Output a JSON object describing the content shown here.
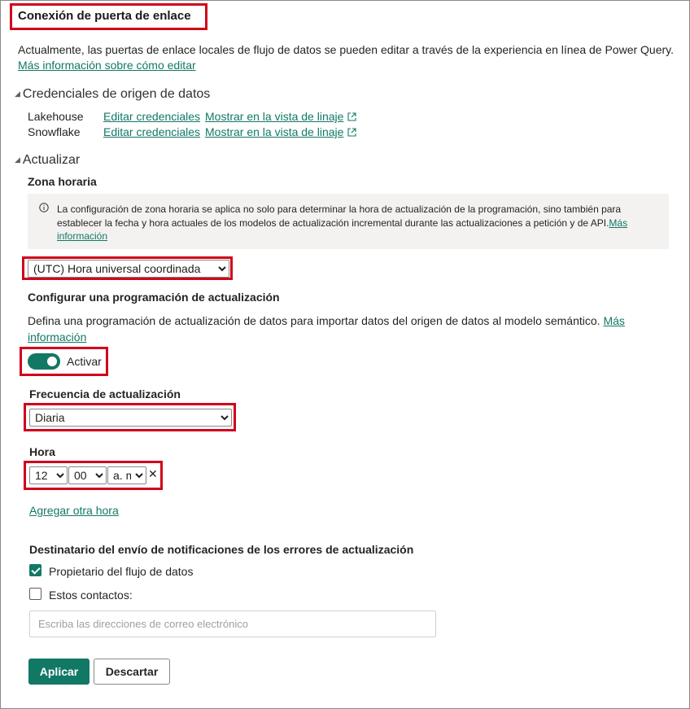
{
  "header": {
    "title": "Conexión de puerta de enlace"
  },
  "intro": {
    "text": "Actualmente, las puertas de enlace locales de flujo de datos se pueden editar a través de la experiencia en línea de Power Query.",
    "link": "Más información sobre cómo editar"
  },
  "credentials": {
    "heading": "Credenciales de origen de datos",
    "rows": [
      {
        "source": "Lakehouse",
        "edit": "Editar credenciales",
        "lineage": "Mostrar en la vista de linaje"
      },
      {
        "source": "Snowflake",
        "edit": "Editar credenciales",
        "lineage": "Mostrar en la vista de linaje"
      }
    ]
  },
  "refresh": {
    "heading": "Actualizar",
    "timezone_label": "Zona horaria",
    "info_text_1": "La configuración de zona horaria se aplica no solo para determinar la hora de actualización de la programación, sino también para",
    "info_text_2": "establecer la fecha y hora actuales de los modelos de actualización incremental durante las actualizaciones a petición y de API.",
    "info_link_1": "Más",
    "info_link_2": "información",
    "timezone_value": "(UTC) Hora universal coordinada",
    "schedule_label": "Configurar una programación de actualización",
    "schedule_desc": "Defina una programación de actualización de datos para importar datos del origen de datos al modelo semántico.",
    "schedule_link_1": "Más",
    "schedule_link_2": "información",
    "toggle_label": "Activar",
    "toggle_on": true,
    "frequency_label": "Frecuencia de actualización",
    "frequency_value": "Diaria",
    "time_label": "Hora",
    "hour_value": "12",
    "minute_value": "00",
    "ampm_value": "a. m",
    "remove_time": "✕",
    "add_time": "Agregar otra hora"
  },
  "notifications": {
    "heading": "Destinatario del envío de notificaciones de los errores de actualización",
    "owner_label": "Propietario del flujo de datos",
    "owner_checked": true,
    "contacts_label": "Estos contactos:",
    "contacts_checked": false,
    "email_placeholder": "Escriba las direcciones de correo electrónico"
  },
  "actions": {
    "apply": "Aplicar",
    "discard": "Descartar"
  },
  "colors": {
    "accent": "#117865",
    "highlight": "#d0021b",
    "info_bg": "#f3f2f1"
  }
}
